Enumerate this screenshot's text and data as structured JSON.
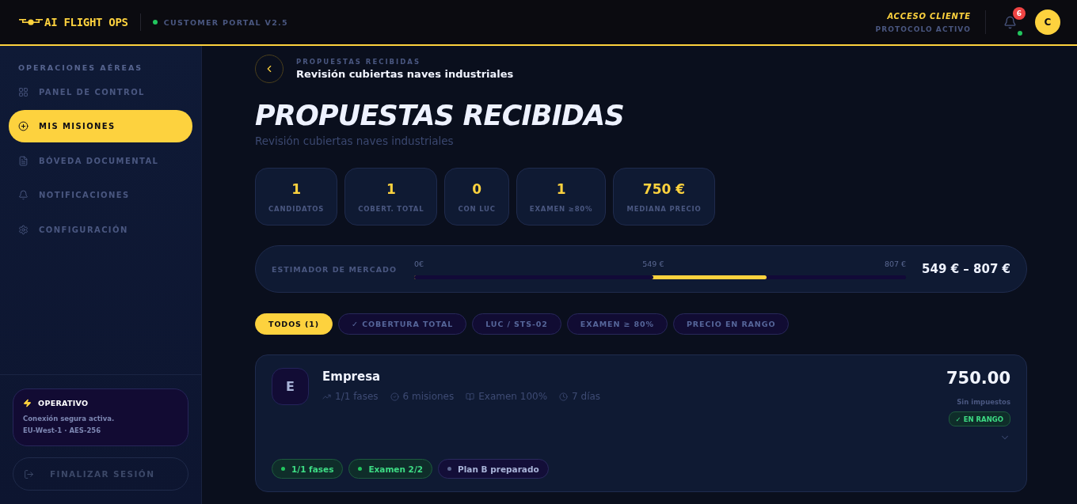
{
  "header": {
    "logo": {
      "text": "AI FLIGHT OPS"
    },
    "portal": {
      "label": "CUSTOMER PORTAL V2.5",
      "online": true
    },
    "access": {
      "title": "ACCESO CLIENTE",
      "subtitle": "PROTOCOLO ACTIVO"
    },
    "notifications": {
      "count": "6",
      "online": true
    },
    "avatar": {
      "initial": "C"
    }
  },
  "sidebar": {
    "section_title": "OPERACIONES AÉREAS",
    "items": [
      {
        "kind": "dashboard",
        "label": "PANEL DE CONTROL",
        "selected": false
      },
      {
        "kind": "missions",
        "label": "MIS MISIONES",
        "selected": true
      },
      {
        "kind": "documents",
        "label": "BÓVEDA DOCUMENTAL",
        "selected": false
      },
      {
        "kind": "notifications",
        "label": "NOTIFICACIONES",
        "selected": false
      },
      {
        "kind": "settings",
        "label": "CONFIGURACIÓN",
        "selected": false
      }
    ],
    "status_card": {
      "title": "OPERATIVO",
      "lines": [
        "Conexión segura activa.",
        "EU-West-1 · AES-256"
      ]
    },
    "logout": {
      "label": "FINALIZAR SESIÓN"
    }
  },
  "page": {
    "breadcrumb": {
      "section": "PROPUESTAS RECIBIDAS",
      "current": "Revisión cubiertas naves industriales"
    },
    "title": "PROPUESTAS RECIBIDAS",
    "subtitle": "Revisión cubiertas naves industriales"
  },
  "stats": [
    {
      "value": "1",
      "label": "CANDIDATOS"
    },
    {
      "value": "1",
      "label": "COBERT. TOTAL"
    },
    {
      "value": "0",
      "label": "CON LUC"
    },
    {
      "value": "1",
      "label": "EXAMEN ≥80%"
    },
    {
      "value": "750 €",
      "label": "MEDIANA PRECIO"
    }
  ],
  "market": {
    "label": "ESTIMADOR DE MERCADO",
    "scale_min": "0€",
    "range_low": "549 €",
    "scale_max": "807 €",
    "range_end": {
      "level": 0.716
    },
    "range_start": {
      "level": 0.486
    },
    "summary": "549 € – 807 €"
  },
  "filters": [
    {
      "label": "TODOS (1)",
      "selected": true
    },
    {
      "label": "✓ COBERTURA TOTAL",
      "selected": false
    },
    {
      "label": "LUC / STS-02",
      "selected": false
    },
    {
      "label": "EXAMEN ≥ 80%",
      "selected": false
    },
    {
      "label": "PRECIO EN RANGO",
      "selected": false
    }
  ],
  "proposals": [
    {
      "initial": "E",
      "name": "Empresa",
      "meta": [
        {
          "kind": "phases",
          "text": "1/1 fases"
        },
        {
          "kind": "missions",
          "text": "6 misiones"
        },
        {
          "kind": "exam",
          "text": "Examen 100%"
        },
        {
          "kind": "time",
          "text": "7 días"
        }
      ],
      "price": "750.00",
      "price_note": "Sin impuestos",
      "badge": "✓ EN RANGO",
      "expanded": false,
      "tags": [
        {
          "kind": "success",
          "text": "1/1 fases"
        },
        {
          "kind": "success",
          "text": "Examen 2/2"
        },
        {
          "kind": "neutral",
          "text": "Plan B preparado"
        }
      ]
    }
  ]
}
